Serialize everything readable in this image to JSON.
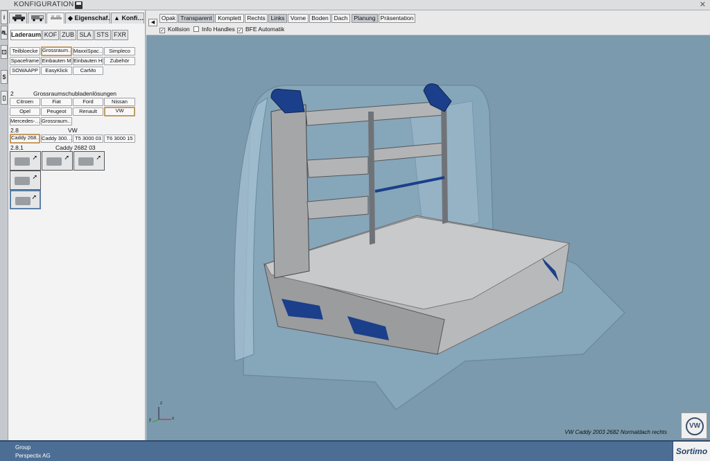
{
  "app": {
    "title": "KONFIGURATION",
    "close_glyph": "✕"
  },
  "left_strip": [
    "i",
    "⛐",
    "⊡",
    "$",
    "▯"
  ],
  "panel": {
    "tabs": [
      {
        "label": "",
        "icon": "car-side-icon"
      },
      {
        "label": "",
        "icon": "van-side-icon"
      },
      {
        "label": "",
        "icon": "shelf-icon",
        "active": true
      },
      {
        "label": "Eigenschaf…",
        "icon": "tag-icon"
      },
      {
        "label": "Konfi…",
        "icon": "warning-icon"
      }
    ],
    "subtabs": [
      {
        "label": "Laderaum",
        "active": true
      },
      {
        "label": "KOF"
      },
      {
        "label": "ZUB"
      },
      {
        "label": "SLA"
      },
      {
        "label": "STS"
      },
      {
        "label": "FXR"
      }
    ],
    "category_buttons": [
      [
        "Teilbloecke",
        "Grossraum…",
        "MaxxiSpac…",
        "Simpleco"
      ],
      [
        "Spaceframe",
        "Einbauten M",
        "Einbauten HD",
        "Zubehör"
      ],
      [
        "SOWAAPP",
        "EasyKlick",
        "CarMo"
      ]
    ],
    "section2_number": "2",
    "section2_title": "Grossraumschubladenlösungen",
    "brand_buttons": [
      [
        "Citroen",
        "Fiat",
        "Ford",
        "Nissan"
      ],
      [
        "Opel",
        "Peugeot",
        "Renault",
        "VW"
      ],
      [
        "Mercedes-…",
        "Grossraum…"
      ]
    ],
    "section28_number": "2.8",
    "section28_title": "VW",
    "model_buttons": [
      "Caddy 268…",
      "Caddy 300…",
      "T5 3000 03",
      "T6 3000 15"
    ],
    "section281_number": "2.8.1",
    "section281_title": "Caddy 2682 03"
  },
  "viewport": {
    "back_icon": "◀",
    "view_buttons": [
      "Opak",
      "Transparent",
      "Komplett",
      "Rechts",
      "Links",
      "Vorne",
      "Boden",
      "Dach",
      "Planung",
      "Präsentation"
    ],
    "active_views": [
      "Transparent",
      "Links",
      "Planung"
    ],
    "checkboxes": [
      {
        "label": "Kollision",
        "checked": true
      },
      {
        "label": "Info Handles",
        "checked": false
      },
      {
        "label": "BFE Automatik",
        "checked": true
      }
    ],
    "caption": "VW Caddy 2003 2682 Normaldach rechts",
    "axes": {
      "z": "z",
      "y": "y",
      "x": "x"
    },
    "logo_text": "VW"
  },
  "status": {
    "line1": "Group",
    "line2": "Perspectix AG",
    "brand": "Sortimo"
  },
  "colors": {
    "viewport_bg": "#7c9aad",
    "statusbar": "#4d6e94",
    "selection_border": "#c49a62",
    "accent_blue": "#1b3f8a"
  }
}
